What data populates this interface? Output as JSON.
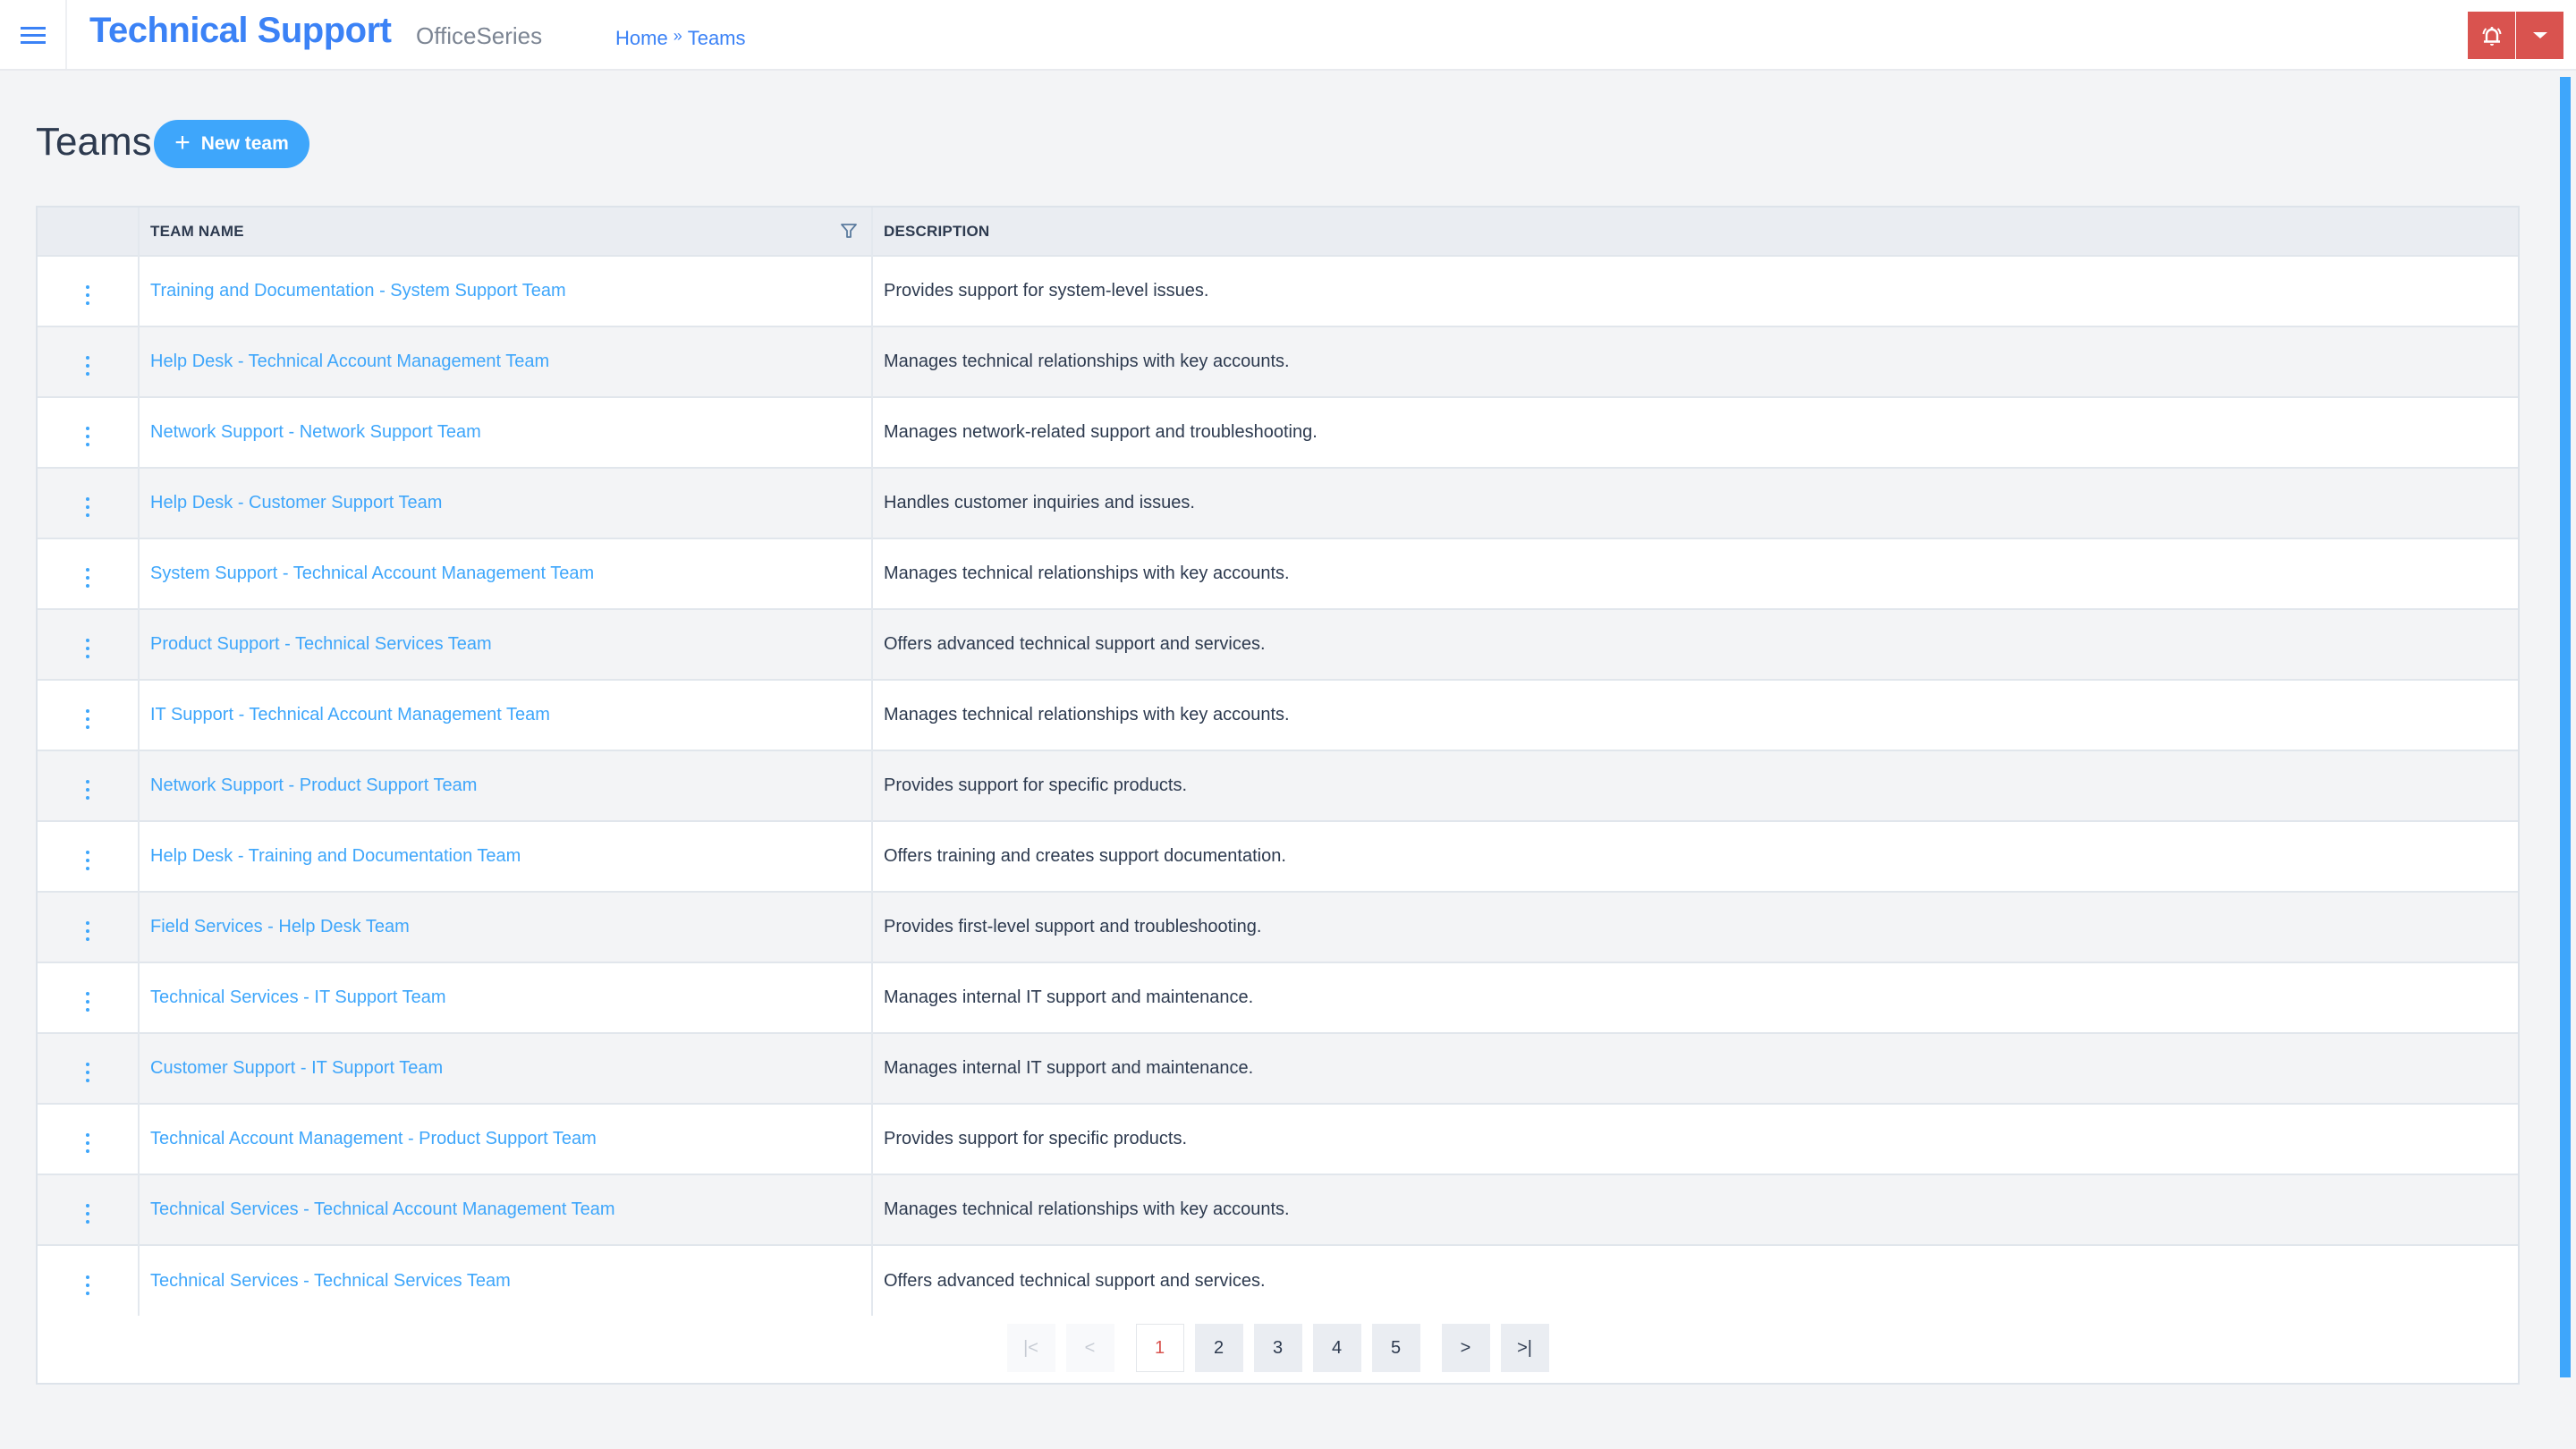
{
  "header": {
    "menu_icon": "hamburger-menu-icon",
    "app_title": "Technical Support",
    "app_subtitle": "OfficeSeries",
    "breadcrumb": [
      {
        "label": "Home"
      },
      {
        "label": "Teams"
      }
    ],
    "breadcrumb_separator": "»",
    "alert_icon": "bell-ring-icon",
    "dropdown_icon": "caret-down-icon",
    "accent_color": "#3b82f6",
    "alert_color": "#d9534f"
  },
  "page": {
    "title": "Teams",
    "new_button": {
      "label": "New team",
      "icon": "plus-icon",
      "color": "#3ea6fb"
    }
  },
  "table": {
    "columns": [
      {
        "label": ""
      },
      {
        "label": "TEAM NAME",
        "filter_icon": "filter-icon"
      },
      {
        "label": "DESCRIPTION"
      }
    ],
    "rows": [
      {
        "name": "Training and Documentation - System Support Team",
        "description": "Provides support for system-level issues."
      },
      {
        "name": "Help Desk - Technical Account Management Team",
        "description": "Manages technical relationships with key accounts."
      },
      {
        "name": "Network Support - Network Support Team",
        "description": "Manages network-related support and troubleshooting."
      },
      {
        "name": "Help Desk - Customer Support Team",
        "description": "Handles customer inquiries and issues."
      },
      {
        "name": "System Support - Technical Account Management Team",
        "description": "Manages technical relationships with key accounts."
      },
      {
        "name": "Product Support - Technical Services Team",
        "description": "Offers advanced technical support and services."
      },
      {
        "name": "IT Support - Technical Account Management Team",
        "description": "Manages technical relationships with key accounts."
      },
      {
        "name": "Network Support - Product Support Team",
        "description": "Provides support for specific products."
      },
      {
        "name": "Help Desk - Training and Documentation Team",
        "description": "Offers training and creates support documentation."
      },
      {
        "name": "Field Services - Help Desk Team",
        "description": "Provides first-level support and troubleshooting."
      },
      {
        "name": "Technical Services - IT Support Team",
        "description": "Manages internal IT support and maintenance."
      },
      {
        "name": "Customer Support - IT Support Team",
        "description": "Manages internal IT support and maintenance."
      },
      {
        "name": "Technical Account Management - Product Support Team",
        "description": "Provides support for specific products."
      },
      {
        "name": "Technical Services - Technical Account Management Team",
        "description": "Manages technical relationships with key accounts."
      },
      {
        "name": "Technical Services - Technical Services Team",
        "description": "Offers advanced technical support and services."
      }
    ]
  },
  "pagination": {
    "first": "|<",
    "prev": "<",
    "pages": [
      "1",
      "2",
      "3",
      "4",
      "5"
    ],
    "current_page": "1",
    "next": ">",
    "last": ">|"
  }
}
